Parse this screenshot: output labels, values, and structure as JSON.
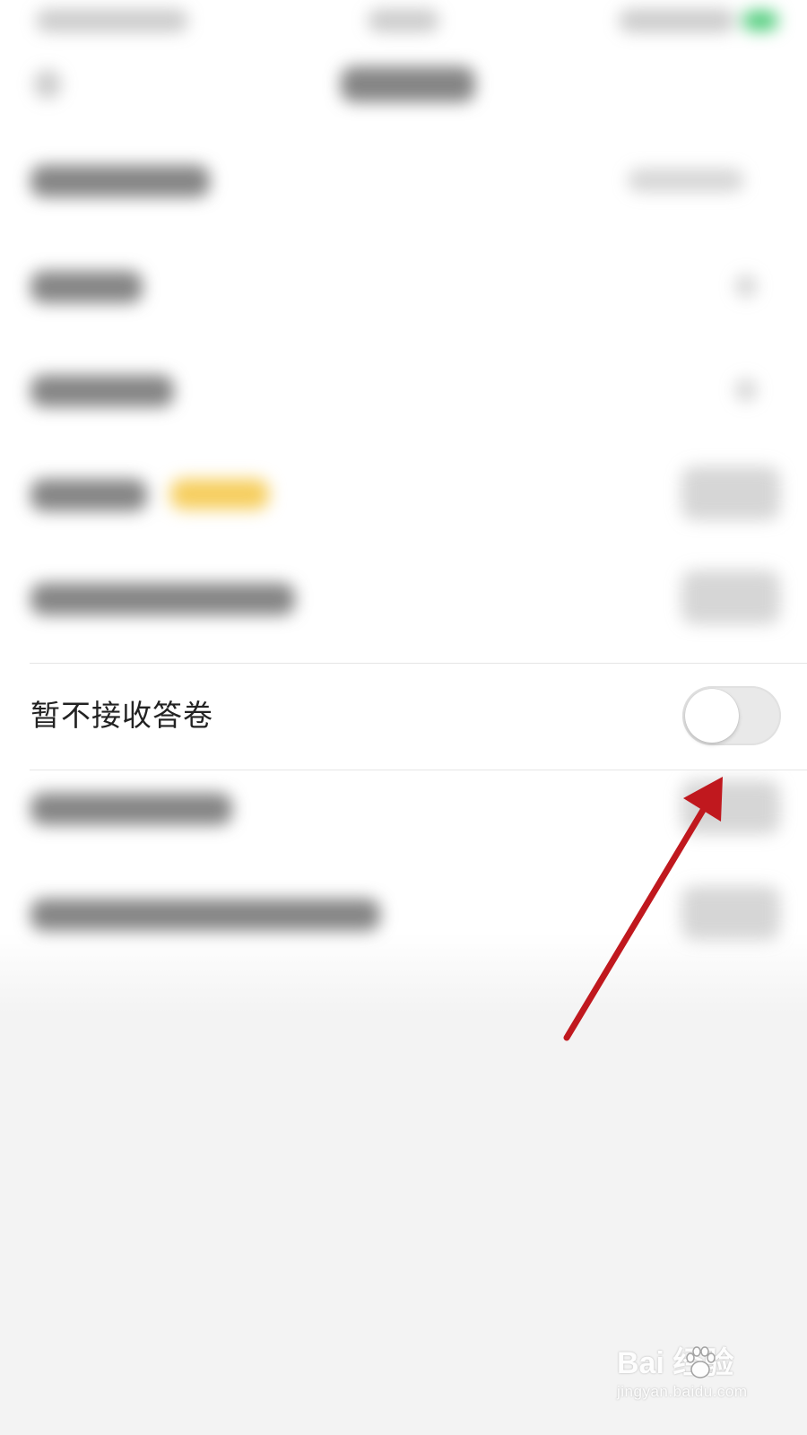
{
  "toggle_row": {
    "label": "暂不接收答卷",
    "enabled": false
  },
  "colors": {
    "arrow": "#c0181e",
    "toggle_off_track": "#e9e9e9",
    "badge_yellow": "#f4c542",
    "battery_green": "#3bc76b"
  },
  "watermark": {
    "brand": "Bai  经验",
    "domain": "jingyan.baidu.com"
  }
}
